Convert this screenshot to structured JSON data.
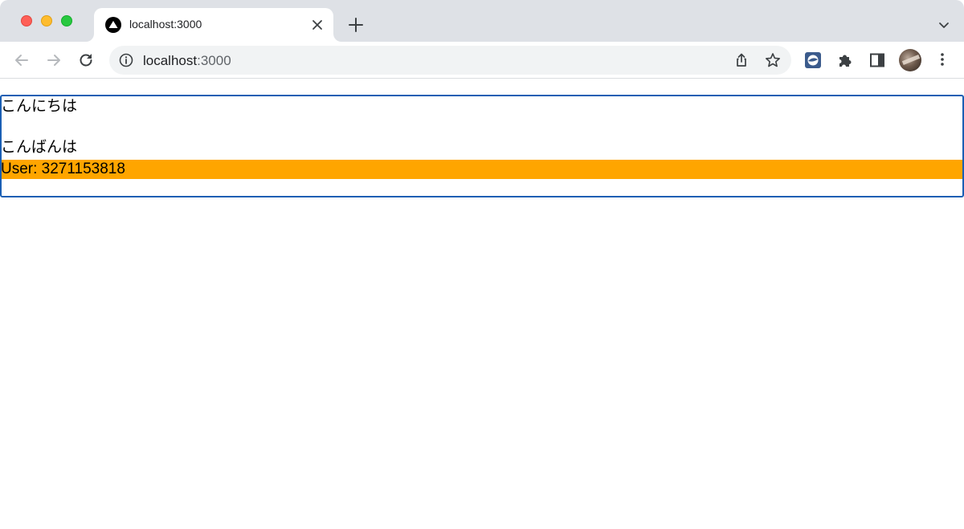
{
  "browser": {
    "tab": {
      "title": "localhost:3000",
      "favicon": "triangle-logo-icon"
    },
    "toolbar": {
      "back": "back-arrow-icon",
      "forward": "forward-arrow-icon",
      "reload": "reload-icon",
      "address": {
        "host": "localhost",
        "port": ":3000",
        "info_icon": "info-icon"
      },
      "share": "share-icon",
      "bookmark": "star-icon",
      "extensions": [
        "extension-badge-icon",
        "puzzle-piece-icon",
        "side-panel-icon"
      ],
      "menu": "vertical-dots-icon"
    },
    "colors": {
      "tabstrip": "#dee1e6",
      "omnibox": "#f1f3f4",
      "focus_outline": "#1a5fb4"
    }
  },
  "page": {
    "greetings": [
      "こんにちは",
      "こんばんは"
    ],
    "user_label": "User: 3271153818",
    "colors": {
      "user_highlight": "#ffa500"
    }
  }
}
